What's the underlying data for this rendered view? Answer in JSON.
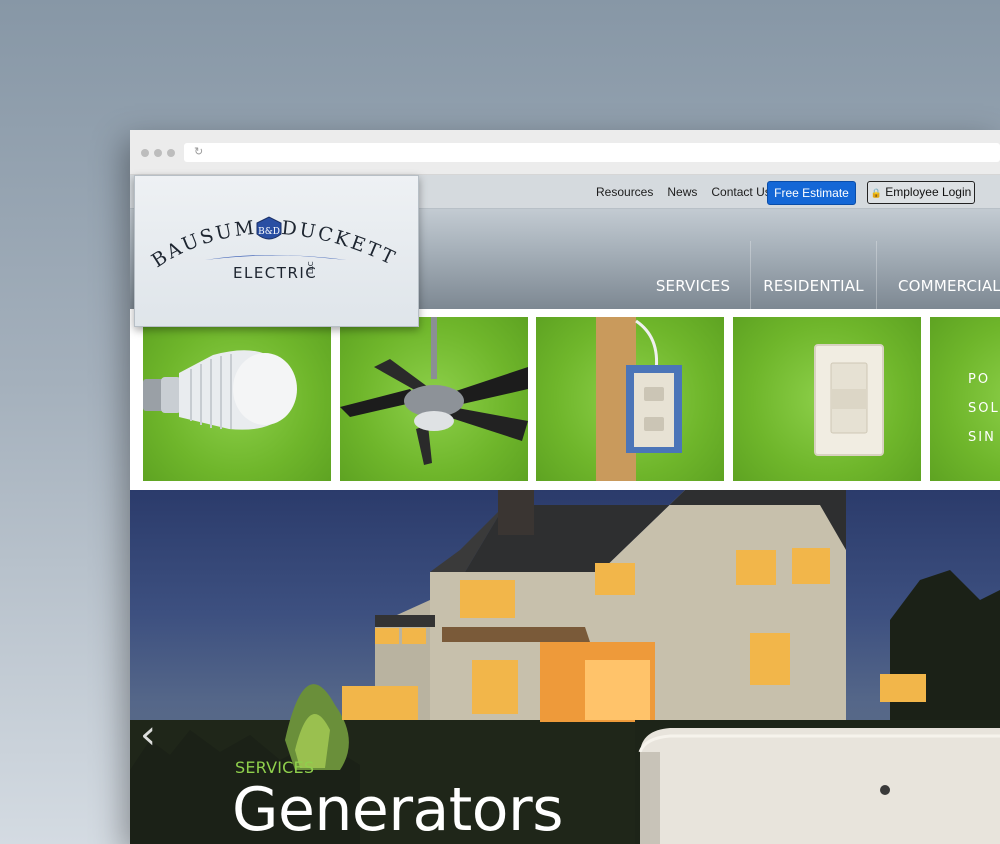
{
  "top_links": [
    "Resources",
    "News",
    "Contact Us"
  ],
  "free_estimate": "Free Estimate",
  "employee_login": "Employee Login",
  "logo": {
    "line1_left": "BAUSUM",
    "monogram": "B&D",
    "line1_right": "DUCKETT",
    "line2": "ELECTRIC",
    "suffix": "LLC"
  },
  "nav": [
    "SERVICES",
    "RESIDENTIAL",
    "COMMERCIAL"
  ],
  "tiles": [
    {
      "icon": "light-bulb"
    },
    {
      "icon": "ceiling-fan"
    },
    {
      "icon": "outlet-box"
    },
    {
      "icon": "light-switch"
    },
    {
      "icon": "text-tile",
      "lines": [
        "PO",
        "SOL",
        "SIN"
      ]
    }
  ],
  "hero": {
    "eyebrow": "SERVICES",
    "title": "Generators",
    "prev_icon": "chevron-left"
  },
  "colors": {
    "accent_green": "#6fb62b",
    "estimate_blue": "#1467d6",
    "eyebrow_green": "#8fd04c"
  }
}
